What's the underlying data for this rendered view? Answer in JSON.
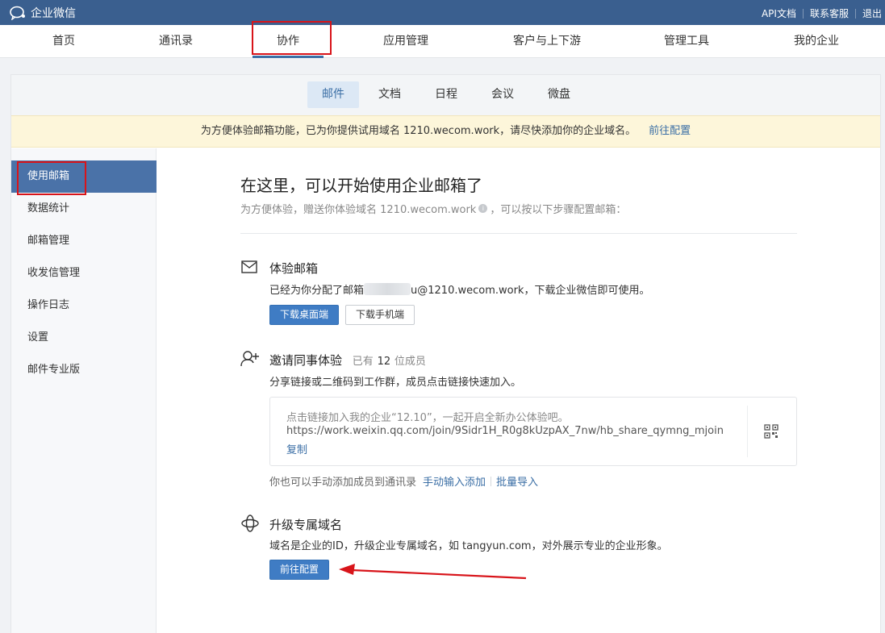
{
  "topbar": {
    "app_title": "企业微信",
    "links": [
      "API文档",
      "联系客服",
      "退出"
    ]
  },
  "mainnav": {
    "items": [
      "首页",
      "通讯录",
      "协作",
      "应用管理",
      "客户与上下游",
      "管理工具",
      "我的企业"
    ],
    "active": "协作"
  },
  "subtabs": {
    "items": [
      "邮件",
      "文档",
      "日程",
      "会议",
      "微盘"
    ],
    "active": "邮件"
  },
  "notice": {
    "text": "为方便体验邮箱功能，已为你提供试用域名 1210.wecom.work，请尽快添加你的企业域名。",
    "link": "前往配置"
  },
  "sidebar": {
    "items": [
      "使用邮箱",
      "数据统计",
      "邮箱管理",
      "收发信管理",
      "操作日志",
      "设置",
      "邮件专业版"
    ],
    "active": "使用邮箱"
  },
  "main": {
    "title": "在这里，可以开始使用企业邮箱了",
    "subtitle_before": "为方便体验，赠送你体验域名 1210.wecom.work",
    "subtitle_after": "，可以按以下步骤配置邮箱：",
    "trial_mail": {
      "title": "体验邮箱",
      "desc_before": "已经为你分配了邮箱",
      "desc_after": "u@1210.wecom.work，下载企业微信即可使用。",
      "btn_desktop": "下载桌面端",
      "btn_mobile": "下载手机端"
    },
    "invite": {
      "title": "邀请同事体验",
      "count_before": "已有",
      "count": "12",
      "count_after": "位成员",
      "desc": "分享链接或二维码到工作群，成员点击链接快速加入。",
      "box_text": "点击链接加入我的企业“12.10”，一起开启全新办公体验吧。",
      "box_url": "https://work.weixin.qq.com/join/9Sidr1H_R0g8kUzpAX_7nw/hb_share_qymng_mjoin",
      "copy": "复制",
      "manual_text": "你也可以手动添加成员到通讯录",
      "manual_link": "手动输入添加",
      "import_link": "批量导入"
    },
    "domain": {
      "title": "升级专属域名",
      "desc": "域名是企业的ID，升级企业专属域名，如 tangyun.com，对外展示专业的企业形象。",
      "btn": "前往配置"
    }
  },
  "colors": {
    "topbar": "#3a5f8f",
    "primary": "#3f7cc4",
    "link": "#3a6ea5",
    "annotation": "#d8141a"
  }
}
